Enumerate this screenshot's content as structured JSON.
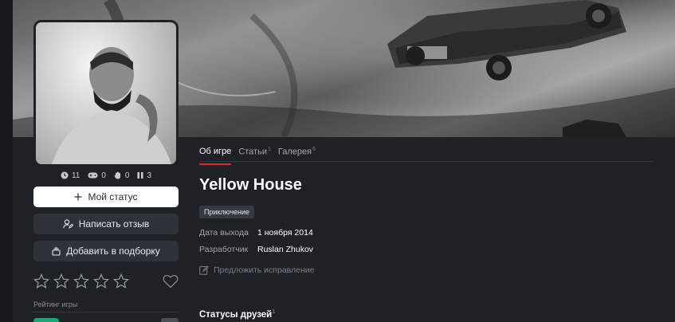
{
  "stats": [
    {
      "icon": "clock-icon",
      "value": "11"
    },
    {
      "icon": "gamepad-icon",
      "value": "0"
    },
    {
      "icon": "hand-icon",
      "value": "0"
    },
    {
      "icon": "pause-icon",
      "value": "3"
    }
  ],
  "buttons": {
    "status": "Мой статус",
    "review": "Написать отзыв",
    "collection": "Добавить в подборку"
  },
  "rating": {
    "label": "Рейтинг игры",
    "stars_filled": 0,
    "stars_total": 5
  },
  "tabs": [
    {
      "label": "Об игре",
      "count": "",
      "active": true
    },
    {
      "label": "Статьи",
      "count": "1",
      "active": false
    },
    {
      "label": "Галерея",
      "count": "6",
      "active": false
    }
  ],
  "game": {
    "title": "Yellow House",
    "genre": "Приключение",
    "release_label": "Дата выхода",
    "release_value": "1 ноября 2014",
    "developer_label": "Разработчик",
    "developer_value": "Ruslan Zhukov",
    "suggest": "Предложить исправление"
  },
  "friends": {
    "title": "Статусы друзей",
    "count": "1"
  },
  "colors": {
    "accent": "#e0252f",
    "green": "#19a974",
    "button_dark": "#2e3239",
    "background": "#1e2126"
  }
}
